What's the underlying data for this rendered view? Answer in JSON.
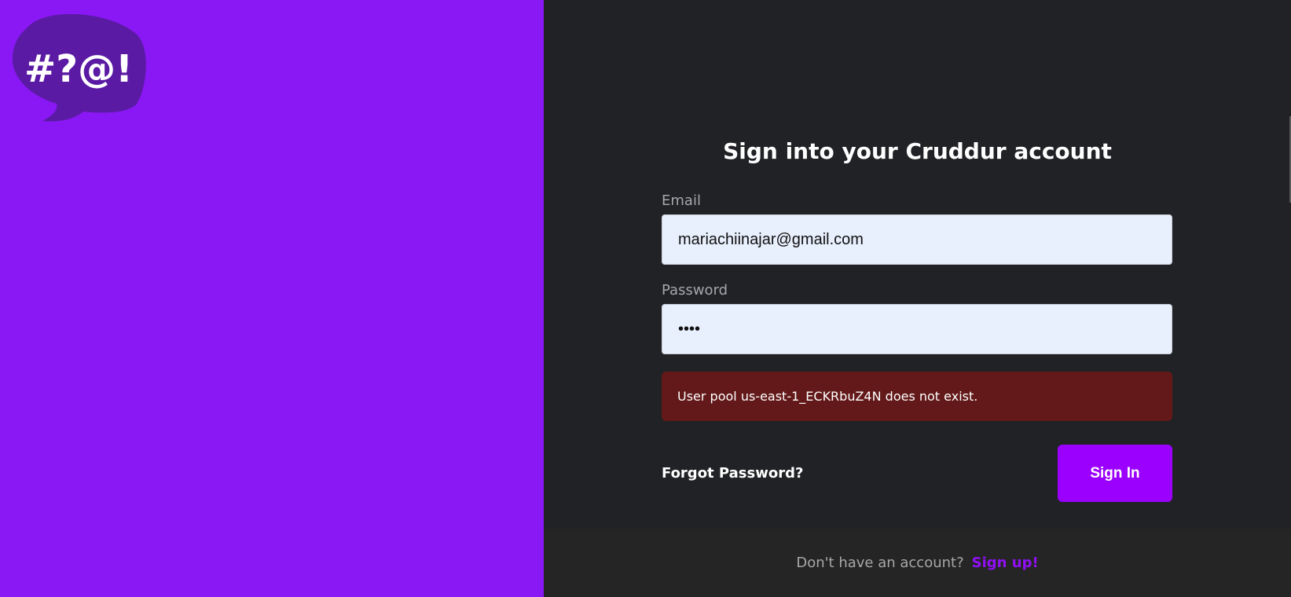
{
  "brand": {
    "logo_text": "#?@!",
    "logo_bubble_color": "#5a1aa3",
    "left_panel_color": "#8a18f4"
  },
  "login": {
    "title": "Sign into your Cruddur account",
    "email": {
      "label": "Email",
      "value": "mariachiinajar@gmail.com"
    },
    "password": {
      "label": "Password",
      "value": "abcd"
    },
    "error_message": "User pool us-east-1_ECKRbuZ4N does not exist.",
    "forgot_password_label": "Forgot Password?",
    "signin_label": "Sign In"
  },
  "footer": {
    "prompt": "Don't have an account?",
    "signup_label": "Sign up!"
  },
  "colors": {
    "accent": "#9b00fe",
    "error_bg": "#631919",
    "panel_bg": "#212225"
  }
}
